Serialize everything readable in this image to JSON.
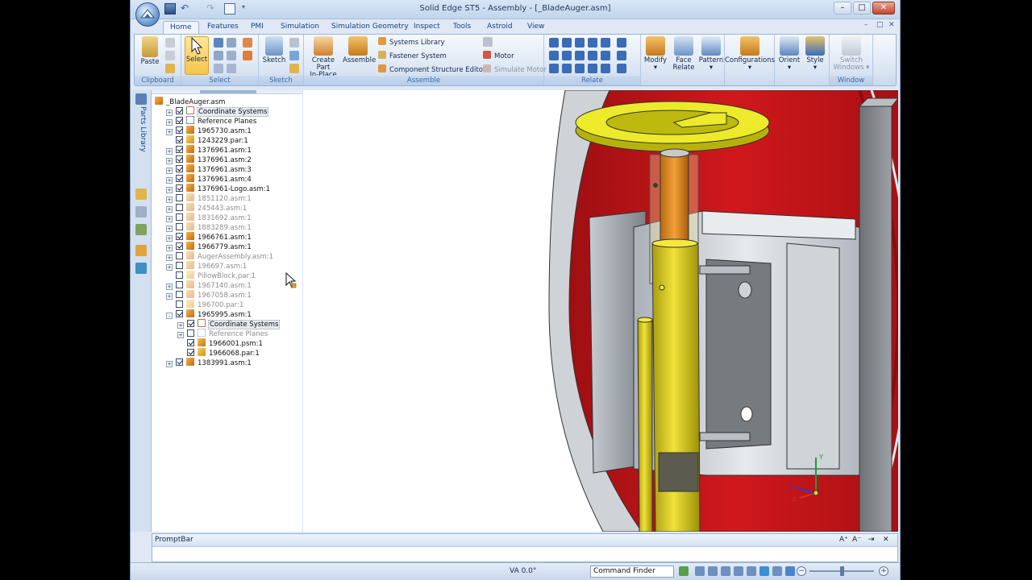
{
  "window": {
    "title": "Solid Edge ST5 - Assembly - [_BladeAuger.asm]",
    "controls": {
      "minimize": "–",
      "maximize": "□",
      "close": "✕"
    }
  },
  "quick_access": {
    "icons": [
      "save-icon",
      "undo-icon",
      "redo-icon",
      "properties-icon",
      "customize-icon"
    ]
  },
  "tabs": [
    "Home",
    "Features",
    "PMI",
    "Simulation",
    "Simulation Geometry",
    "Inspect",
    "Tools",
    "Astroid",
    "View"
  ],
  "active_tab": "Home",
  "mdi_controls": {
    "minimize": "–",
    "restore": "□",
    "close": "✕"
  },
  "ribbon": {
    "clipboard": {
      "label": "Clipboard",
      "paste": "Paste"
    },
    "select": {
      "label": "Select",
      "select": "Select"
    },
    "sketch": {
      "label": "Sketch",
      "sketch": "Sketch"
    },
    "assemble": {
      "label": "Assemble",
      "create_part": "Create Part",
      "in_place": "In-Place",
      "assemble": "Assemble",
      "systems_library": "Systems Library",
      "fastener_system": "Fastener System",
      "component_structure_editor": "Component Structure Editor",
      "motor": "Motor",
      "simulate_motor": "Simulate Motor"
    },
    "relate": {
      "label": "Relate"
    },
    "modify": "Modify",
    "face_relate_1": "Face",
    "face_relate_2": "Relate",
    "pattern": "Pattern",
    "configurations": "Configurations",
    "orient": "Orient",
    "style": "Style",
    "window": {
      "label": "Window",
      "switch_1": "Switch",
      "switch_2": "Windows"
    }
  },
  "side_panel": {
    "parts_library": "Parts Library"
  },
  "tree": [
    {
      "label": "_BladeAuger.asm",
      "level": 0,
      "expander": "none",
      "checkbox": "none",
      "icon": "asm",
      "dim": false,
      "highlight": false
    },
    {
      "label": "Coordinate Systems",
      "level": 1,
      "expander": "+",
      "checkbox": "on",
      "icon": "coord",
      "dim": false,
      "highlight": true
    },
    {
      "label": "Reference Planes",
      "level": 1,
      "expander": "+",
      "checkbox": "on",
      "icon": "ref",
      "dim": false,
      "highlight": false
    },
    {
      "label": "1965730.asm:1",
      "level": 1,
      "expander": "+",
      "checkbox": "on",
      "icon": "asm",
      "dim": false,
      "highlight": false
    },
    {
      "label": "1243229.par:1",
      "level": 1,
      "expander": "none",
      "checkbox": "on",
      "icon": "par",
      "dim": false,
      "highlight": false
    },
    {
      "label": "1376961.asm:1",
      "level": 1,
      "expander": "+",
      "checkbox": "on",
      "icon": "asm",
      "dim": false,
      "highlight": false
    },
    {
      "label": "1376961.asm:2",
      "level": 1,
      "expander": "+",
      "checkbox": "on",
      "icon": "asm",
      "dim": false,
      "highlight": false
    },
    {
      "label": "1376961.asm:3",
      "level": 1,
      "expander": "+",
      "checkbox": "on",
      "icon": "asm",
      "dim": false,
      "highlight": false
    },
    {
      "label": "1376961.asm:4",
      "level": 1,
      "expander": "+",
      "checkbox": "on",
      "icon": "asm",
      "dim": false,
      "highlight": false
    },
    {
      "label": "1376961-Logo.asm:1",
      "level": 1,
      "expander": "+",
      "checkbox": "on",
      "icon": "asm",
      "dim": false,
      "highlight": false
    },
    {
      "label": "1851120.asm:1",
      "level": 1,
      "expander": "+",
      "checkbox": "off",
      "icon": "asm",
      "dim": true,
      "highlight": false
    },
    {
      "label": "245443.asm:1",
      "level": 1,
      "expander": "+",
      "checkbox": "off",
      "icon": "asm",
      "dim": true,
      "highlight": false
    },
    {
      "label": "1831692.asm:1",
      "level": 1,
      "expander": "+",
      "checkbox": "off",
      "icon": "asm",
      "dim": true,
      "highlight": false
    },
    {
      "label": "1883289.asm:1",
      "level": 1,
      "expander": "+",
      "checkbox": "off",
      "icon": "asm",
      "dim": true,
      "highlight": false
    },
    {
      "label": "1966761.asm:1",
      "level": 1,
      "expander": "+",
      "checkbox": "on",
      "icon": "asm",
      "dim": false,
      "highlight": false
    },
    {
      "label": "1966779.asm:1",
      "level": 1,
      "expander": "+",
      "checkbox": "on",
      "icon": "asm",
      "dim": false,
      "highlight": false
    },
    {
      "label": "AugerAssembly.asm:1",
      "level": 1,
      "expander": "+",
      "checkbox": "off",
      "icon": "asm",
      "dim": true,
      "highlight": false
    },
    {
      "label": "196697.asm:1",
      "level": 1,
      "expander": "+",
      "checkbox": "off",
      "icon": "asm",
      "dim": true,
      "highlight": false
    },
    {
      "label": "PillowBlock.par:1",
      "level": 1,
      "expander": "none",
      "checkbox": "off",
      "icon": "par",
      "dim": true,
      "highlight": false
    },
    {
      "label": "1967140.asm:1",
      "level": 1,
      "expander": "+",
      "checkbox": "off",
      "icon": "asm",
      "dim": true,
      "highlight": false
    },
    {
      "label": "1967058.asm:1",
      "level": 1,
      "expander": "+",
      "checkbox": "off",
      "icon": "asm",
      "dim": true,
      "highlight": false
    },
    {
      "label": "196700.par:1",
      "level": 1,
      "expander": "none",
      "checkbox": "off",
      "icon": "par",
      "dim": true,
      "highlight": false
    },
    {
      "label": "1965995.asm:1",
      "level": 1,
      "expander": "–",
      "checkbox": "on",
      "icon": "asm",
      "dim": false,
      "highlight": false
    },
    {
      "label": "Coordinate Systems",
      "level": 2,
      "expander": "+",
      "checkbox": "on",
      "icon": "coord",
      "dim": false,
      "highlight": true
    },
    {
      "label": "Reference Planes",
      "level": 2,
      "expander": "+",
      "checkbox": "off",
      "icon": "ref",
      "dim": true,
      "highlight": false
    },
    {
      "label": "1966001.psm:1",
      "level": 2,
      "expander": "none",
      "checkbox": "on",
      "icon": "psm",
      "dim": false,
      "highlight": false
    },
    {
      "label": "1966068.par:1",
      "level": 2,
      "expander": "none",
      "checkbox": "on",
      "icon": "par",
      "dim": false,
      "highlight": false
    },
    {
      "label": "1383991.asm:1",
      "level": 1,
      "expander": "+",
      "checkbox": "on",
      "icon": "asm",
      "dim": false,
      "highlight": false
    }
  ],
  "viewport": {
    "triad": {
      "x": "X",
      "y": "Y",
      "z": "Z"
    },
    "colors": {
      "drum": "#c8161a",
      "handwheel": "#e6e61e",
      "shaft": "#d4c61a",
      "inner_rod": "#e08a1e",
      "bracket": "#d4d8de",
      "frame": "#9aa0a6"
    }
  },
  "promptbar": {
    "title": "PromptBar",
    "controls": {
      "grow": "A⁺",
      "shrink": "A⁻",
      "pin": "⇥",
      "close": "✕"
    }
  },
  "statusbar": {
    "va": "VA 0.0°",
    "command_finder": "Command Finder",
    "icons": [
      "refresh-icon",
      "fit-icon",
      "zoom-area-icon",
      "zoom-icon",
      "pan-icon",
      "rotate-icon",
      "view-style-icon",
      "sketch-view-icon",
      "shaded-icon",
      "previous-view-icon"
    ],
    "zoom_out": "−",
    "zoom_in": "+"
  }
}
